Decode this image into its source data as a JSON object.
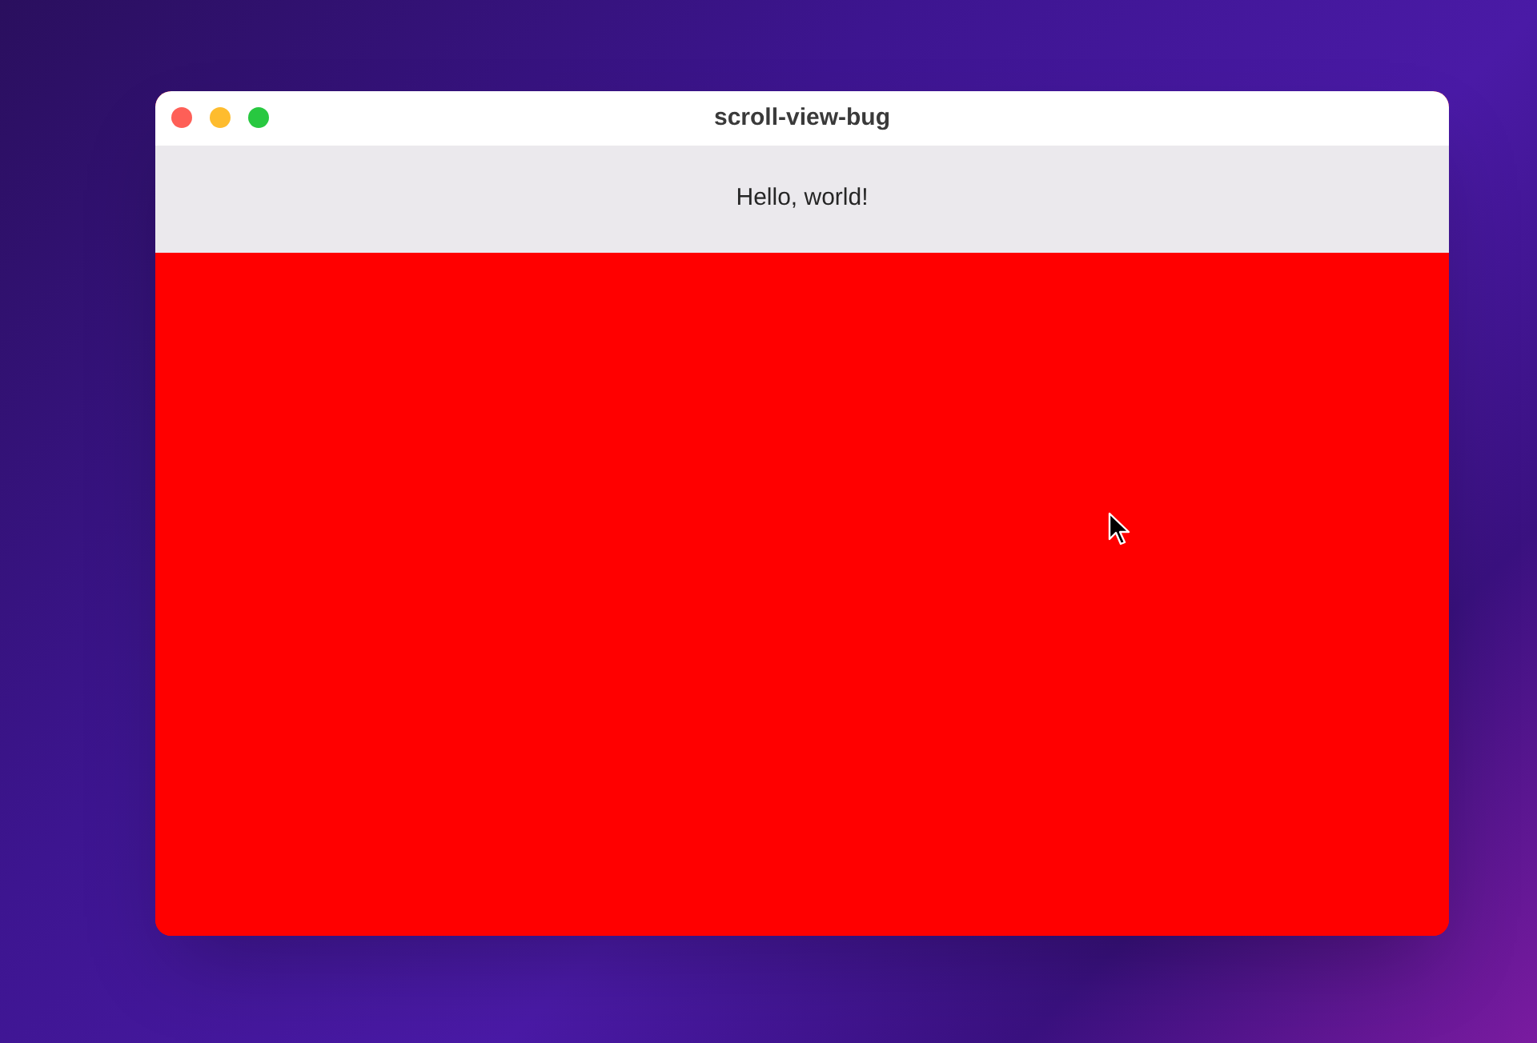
{
  "window": {
    "title": "scroll-view-bug"
  },
  "content": {
    "text": "Hello, world!"
  }
}
